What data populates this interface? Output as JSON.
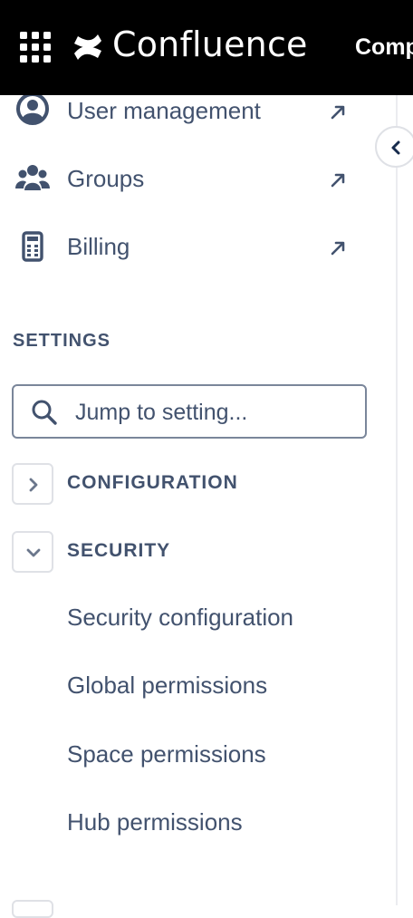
{
  "topbar": {
    "app_name": "Confluence",
    "nav_partial": "Comp",
    "apps_icon": "grid-icon",
    "logo_icon": "confluence-logo-icon",
    "background": "#000000"
  },
  "sidebar": {
    "links": [
      {
        "label": "User management",
        "icon": "user-circle-icon",
        "external": true
      },
      {
        "label": "Groups",
        "icon": "people-group-icon",
        "external": true
      },
      {
        "label": "Billing",
        "icon": "calculator-icon",
        "external": true
      }
    ],
    "settings_title": "SETTINGS",
    "search": {
      "placeholder": "Jump to setting...",
      "value": ""
    },
    "groups": [
      {
        "label": "CONFIGURATION",
        "expanded": false
      },
      {
        "label": "SECURITY",
        "expanded": true,
        "items": [
          "Security configuration",
          "Global permissions",
          "Space permissions",
          "Hub permissions"
        ]
      }
    ],
    "collapse_icon": "chevron-left-icon"
  },
  "colors": {
    "text": "#42526E",
    "border": "#DFE1E6",
    "input_border": "#7A869A",
    "divider": "#EBECF0"
  }
}
